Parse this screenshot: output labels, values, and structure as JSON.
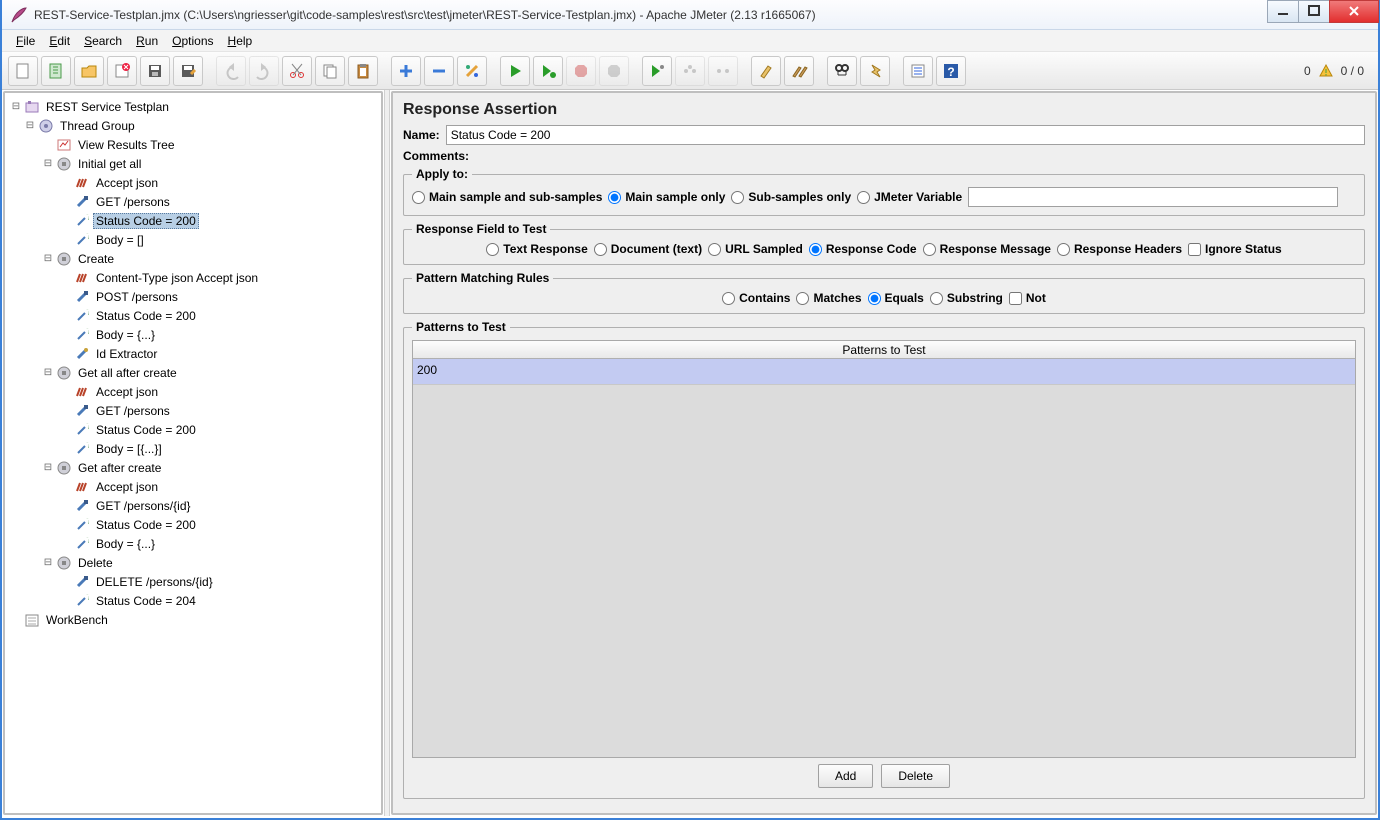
{
  "window": {
    "title": "REST-Service-Testplan.jmx (C:\\Users\\ngriesser\\git\\code-samples\\rest\\src\\test\\jmeter\\REST-Service-Testplan.jmx) - Apache JMeter (2.13 r1665067)"
  },
  "menu": {
    "file": "File",
    "edit": "Edit",
    "search": "Search",
    "run": "Run",
    "options": "Options",
    "help": "Help"
  },
  "status": {
    "left": "0",
    "right": "0 / 0"
  },
  "tree": {
    "root": "REST Service Testplan",
    "threadGroup": "Thread Group",
    "viewResults": "View Results Tree",
    "c1": {
      "name": "Initial get all",
      "i": [
        "Accept json",
        "GET /persons",
        "Status Code = 200",
        "Body = []"
      ]
    },
    "c2": {
      "name": "Create",
      "i": [
        "Content-Type json Accept json",
        "POST /persons",
        "Status Code = 200",
        "Body = {...}",
        "Id Extractor"
      ]
    },
    "c3": {
      "name": "Get all after create",
      "i": [
        "Accept json",
        "GET /persons",
        "Status Code = 200",
        "Body = [{...}]"
      ]
    },
    "c4": {
      "name": "Get after create",
      "i": [
        "Accept json",
        "GET /persons/{id}",
        "Status Code = 200",
        "Body = {...}"
      ]
    },
    "c5": {
      "name": "Delete",
      "i": [
        "DELETE /persons/{id}",
        "Status Code = 204"
      ]
    },
    "workbench": "WorkBench"
  },
  "panel": {
    "title": "Response Assertion",
    "nameLabel": "Name:",
    "nameValue": "Status Code = 200",
    "commentsLabel": "Comments:",
    "applyLegend": "Apply to:",
    "apply": {
      "a": "Main sample and sub-samples",
      "b": "Main sample only",
      "c": "Sub-samples only",
      "d": "JMeter Variable"
    },
    "fieldLegend": "Response Field to Test",
    "field": {
      "a": "Text Response",
      "b": "Document (text)",
      "c": "URL Sampled",
      "d": "Response Code",
      "e": "Response Message",
      "f": "Response Headers",
      "g": "Ignore Status"
    },
    "ruleLegend": "Pattern Matching Rules",
    "rule": {
      "a": "Contains",
      "b": "Matches",
      "c": "Equals",
      "d": "Substring",
      "e": "Not"
    },
    "patternsLegend": "Patterns to Test",
    "patternsHeader": "Patterns to Test",
    "patternRow": "200",
    "addBtn": "Add",
    "deleteBtn": "Delete"
  }
}
